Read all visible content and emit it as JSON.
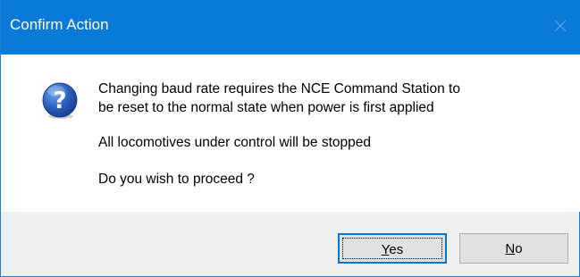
{
  "window": {
    "title": "Confirm Action",
    "close_icon": "close-icon",
    "titlebar_color": "#0a7ad9"
  },
  "message": {
    "icon": "question-icon",
    "lines": [
      "Changing baud rate requires the NCE Command Station to",
      "be reset to the normal state when power is first applied",
      "All locomotives under control will be stopped",
      "Do you wish to proceed ?"
    ]
  },
  "buttons": {
    "yes": {
      "mnemonic": "Y",
      "rest": "es"
    },
    "no": {
      "mnemonic": "N",
      "rest": "o"
    }
  }
}
